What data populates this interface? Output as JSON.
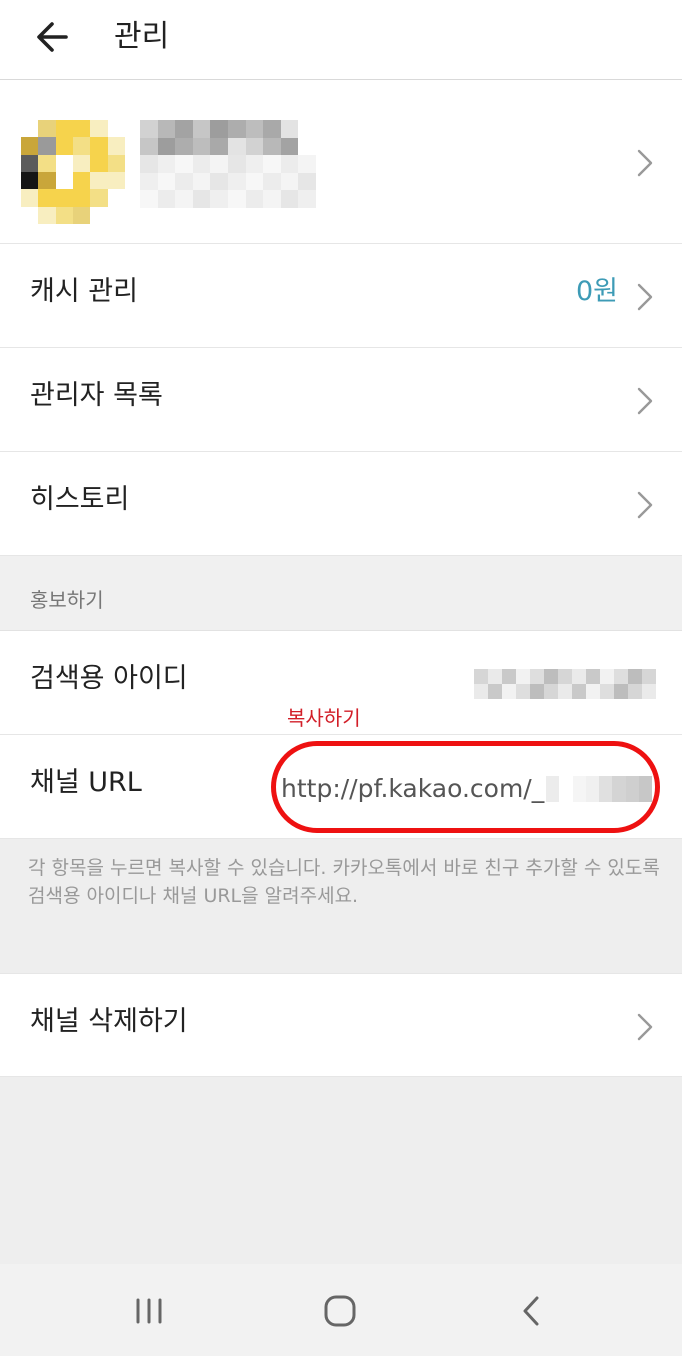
{
  "header": {
    "title": "관리"
  },
  "profile": {},
  "menu": {
    "cash": {
      "label": "캐시 관리",
      "value": "0원"
    },
    "admins": {
      "label": "관리자 목록"
    },
    "history": {
      "label": "히스토리"
    }
  },
  "promo": {
    "section_title": "홍보하기",
    "search_id": {
      "label": "검색용 아이디"
    },
    "channel_url": {
      "label": "채널 URL",
      "value": "http://pf.kakao.com/_"
    },
    "annotation": "복사하기",
    "help_text": "각 항목을 누르면 복사할 수 있습니다. 카카오톡에서 바로 친구 추가할 수 있도록 검색용 아이디나 채널 URL을 알려주세요."
  },
  "delete": {
    "label": "채널 삭제하기"
  },
  "colors": {
    "accent": "#3d9bb6",
    "annotation": "#d21e28"
  },
  "icons": [
    "back-arrow-icon",
    "chevron-right-icon",
    "recent-apps-icon",
    "home-icon",
    "back-icon"
  ]
}
